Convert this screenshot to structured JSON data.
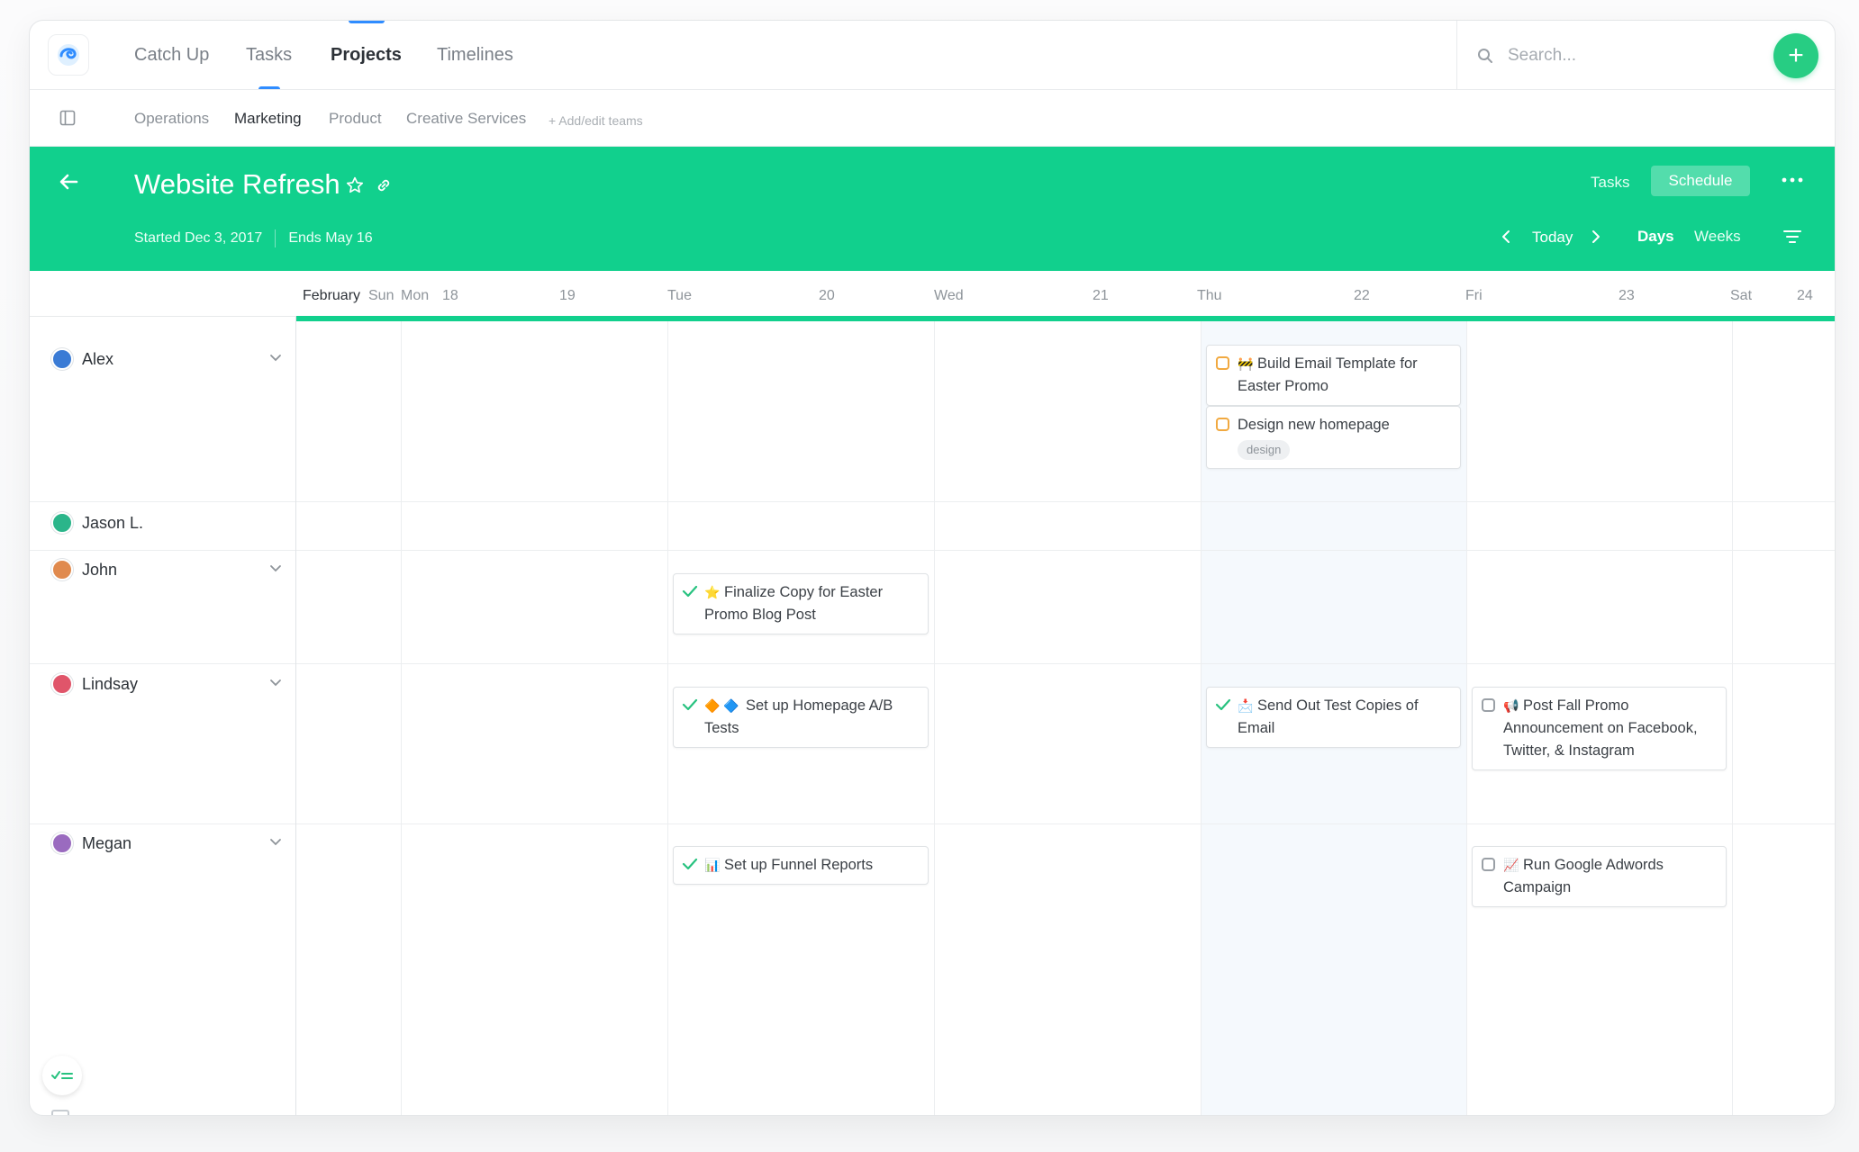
{
  "nav": {
    "items": [
      "Catch Up",
      "Tasks",
      "Projects",
      "Timelines"
    ],
    "active": "Projects"
  },
  "search": {
    "placeholder": "Search..."
  },
  "add_button": "+",
  "teams": {
    "items": [
      "Operations",
      "Marketing",
      "Product",
      "Creative Services"
    ],
    "active": "Marketing",
    "add_label": "+ Add/edit teams"
  },
  "project": {
    "title": "Website Refresh",
    "started": "Started Dec 3, 2017",
    "ends": "Ends May 16",
    "view_tasks": "Tasks",
    "view_schedule": "Schedule",
    "today": "Today",
    "days": "Days",
    "weeks": "Weeks"
  },
  "calendar": {
    "month": "February",
    "headers": [
      "Sun",
      "Mon",
      "18",
      "19",
      "Tue",
      "20",
      "Wed",
      "21",
      "Thu",
      "22",
      "Fri",
      "23",
      "Sat",
      "24"
    ]
  },
  "people": [
    {
      "name": "Alex",
      "avatar_color": "#3a7bd5"
    },
    {
      "name": "Jason L.",
      "avatar_color": "#2bb58a"
    },
    {
      "name": "John",
      "avatar_color": "#e08a4e"
    },
    {
      "name": "Lindsay",
      "avatar_color": "#e0556a"
    },
    {
      "name": "Megan",
      "avatar_color": "#9a6bbf"
    }
  ],
  "tasks": {
    "alex_1": {
      "title": "Build Email Template for Easter Promo",
      "emoji": "🚧",
      "status": "open"
    },
    "alex_2": {
      "title": "Design new homepage",
      "tag": "design",
      "status": "open"
    },
    "john_1": {
      "title": "Finalize Copy for Easter Promo Blog Post",
      "emoji": "⭐",
      "status": "done"
    },
    "lindsay_1": {
      "title": "Set up Homepage A/B Tests",
      "emoji": "🔶 🔷",
      "status": "done"
    },
    "lindsay_2": {
      "title": "Send Out Test Copies of Email",
      "emoji": "📩",
      "status": "done"
    },
    "lindsay_3": {
      "title": "Post Fall Promo Announcement on Facebook, Twitter, & Instagram",
      "emoji": "📢",
      "status": "todo"
    },
    "megan_1": {
      "title": "Set up Funnel Reports",
      "emoji": "📊",
      "status": "done"
    },
    "megan_2": {
      "title": "Run Google Adwords Campaign",
      "emoji": "📈",
      "status": "todo"
    }
  },
  "colors": {
    "brand_green": "#11d08d",
    "accent_blue": "#2f8cff",
    "add_green": "#27cd83"
  }
}
